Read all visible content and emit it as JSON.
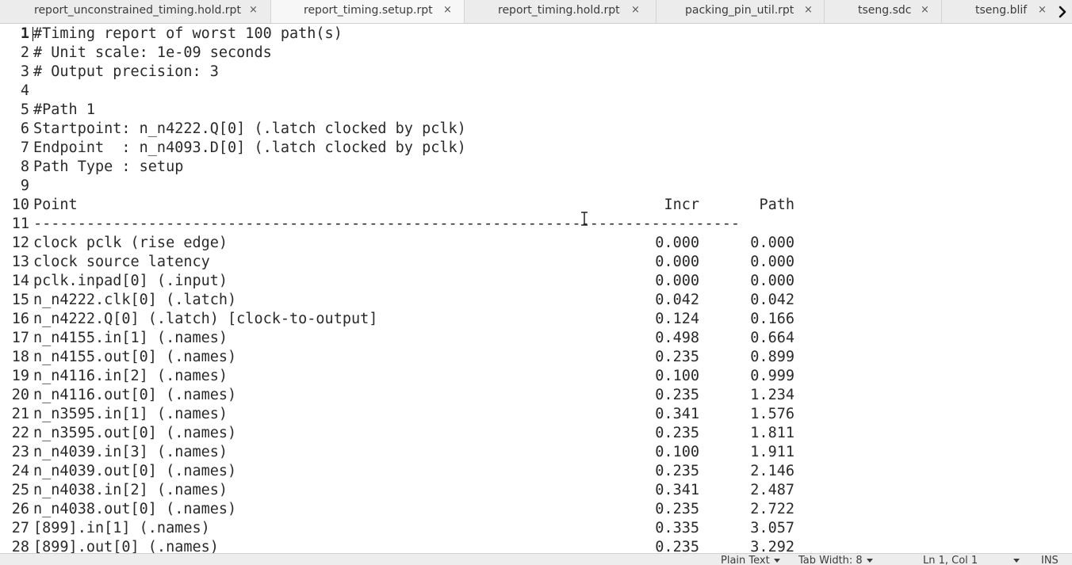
{
  "tabs": [
    {
      "label": "report_unconstrained_timing.hold.rpt",
      "close": "×",
      "active": false
    },
    {
      "label": "report_timing.setup.rpt",
      "close": "×",
      "active": true
    },
    {
      "label": "report_timing.hold.rpt",
      "close": "×",
      "active": false
    },
    {
      "label": "packing_pin_util.rpt",
      "close": "×",
      "active": false
    },
    {
      "label": "tseng.sdc",
      "close": "×",
      "active": false
    },
    {
      "label": "tseng.blif",
      "close": "×",
      "active": false
    }
  ],
  "editor": {
    "header_lines": [
      {
        "n": "1",
        "text": "#Timing report of worst 100 path(s)"
      },
      {
        "n": "2",
        "text": "# Unit scale: 1e-09 seconds"
      },
      {
        "n": "3",
        "text": "# Output precision: 3"
      },
      {
        "n": "4",
        "text": ""
      },
      {
        "n": "5",
        "text": "#Path 1"
      },
      {
        "n": "6",
        "text": "Startpoint: n_n4222.Q[0] (.latch clocked by pclk)"
      },
      {
        "n": "7",
        "text": "Endpoint  : n_n4093.D[0] (.latch clocked by pclk)"
      },
      {
        "n": "8",
        "text": "Path Type : setup"
      },
      {
        "n": "9",
        "text": ""
      }
    ],
    "table_header": {
      "n": "10",
      "point": "Point",
      "incr": "Incr",
      "path": "Path"
    },
    "separator": {
      "n": "11",
      "text": "--------------------------------------------------------------------------------"
    },
    "rows": [
      {
        "n": "12",
        "point": "clock pclk (rise edge)",
        "incr": "0.000",
        "path": "0.000"
      },
      {
        "n": "13",
        "point": "clock source latency",
        "incr": "0.000",
        "path": "0.000"
      },
      {
        "n": "14",
        "point": "pclk.inpad[0] (.input)",
        "incr": "0.000",
        "path": "0.000"
      },
      {
        "n": "15",
        "point": "n_n4222.clk[0] (.latch)",
        "incr": "0.042",
        "path": "0.042"
      },
      {
        "n": "16",
        "point": "n_n4222.Q[0] (.latch) [clock-to-output]",
        "incr": "0.124",
        "path": "0.166"
      },
      {
        "n": "17",
        "point": "n_n4155.in[1] (.names)",
        "incr": "0.498",
        "path": "0.664"
      },
      {
        "n": "18",
        "point": "n_n4155.out[0] (.names)",
        "incr": "0.235",
        "path": "0.899"
      },
      {
        "n": "19",
        "point": "n_n4116.in[2] (.names)",
        "incr": "0.100",
        "path": "0.999"
      },
      {
        "n": "20",
        "point": "n_n4116.out[0] (.names)",
        "incr": "0.235",
        "path": "1.234"
      },
      {
        "n": "21",
        "point": "n_n3595.in[1] (.names)",
        "incr": "0.341",
        "path": "1.576"
      },
      {
        "n": "22",
        "point": "n_n3595.out[0] (.names)",
        "incr": "0.235",
        "path": "1.811"
      },
      {
        "n": "23",
        "point": "n_n4039.in[3] (.names)",
        "incr": "0.100",
        "path": "1.911"
      },
      {
        "n": "24",
        "point": "n_n4039.out[0] (.names)",
        "incr": "0.235",
        "path": "2.146"
      },
      {
        "n": "25",
        "point": "n_n4038.in[2] (.names)",
        "incr": "0.341",
        "path": "2.487"
      },
      {
        "n": "26",
        "point": "n_n4038.out[0] (.names)",
        "incr": "0.235",
        "path": "2.722"
      },
      {
        "n": "27",
        "point": "[899].in[1] (.names)",
        "incr": "0.335",
        "path": "3.057"
      },
      {
        "n": "28",
        "point": "[899].out[0] (.names)",
        "incr": "0.235",
        "path": "3.292"
      }
    ]
  },
  "statusbar": {
    "language": "Plain Text",
    "tab_width": "Tab Width: 8",
    "position": "Ln 1, Col 1",
    "mode": "INS"
  }
}
